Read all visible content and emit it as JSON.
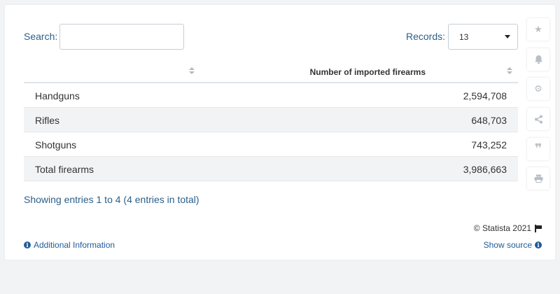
{
  "search": {
    "label": "Search:",
    "value": "",
    "placeholder": ""
  },
  "records": {
    "label": "Records:",
    "selected": "13"
  },
  "table": {
    "columns": [
      "",
      "Number of imported firearms"
    ],
    "rows": [
      {
        "name": "Handguns",
        "value": "2,594,708"
      },
      {
        "name": "Rifles",
        "value": "648,703"
      },
      {
        "name": "Shotguns",
        "value": "743,252"
      },
      {
        "name": "Total firearms",
        "value": "3,986,663"
      }
    ]
  },
  "footer": {
    "showing": "Showing entries 1 to 4 (4 entries in total)",
    "copyright": "© Statista 2021",
    "additional_info": "Additional Information",
    "show_source": "Show source"
  },
  "sidebar": {
    "icons": [
      "star-icon",
      "bell-icon",
      "gear-icon",
      "share-icon",
      "quote-icon",
      "print-icon"
    ]
  },
  "colors": {
    "accent": "#2c5f8a",
    "link": "#1f5c99",
    "row_alt": "#f1f3f5",
    "icon": "#b8bec4"
  }
}
